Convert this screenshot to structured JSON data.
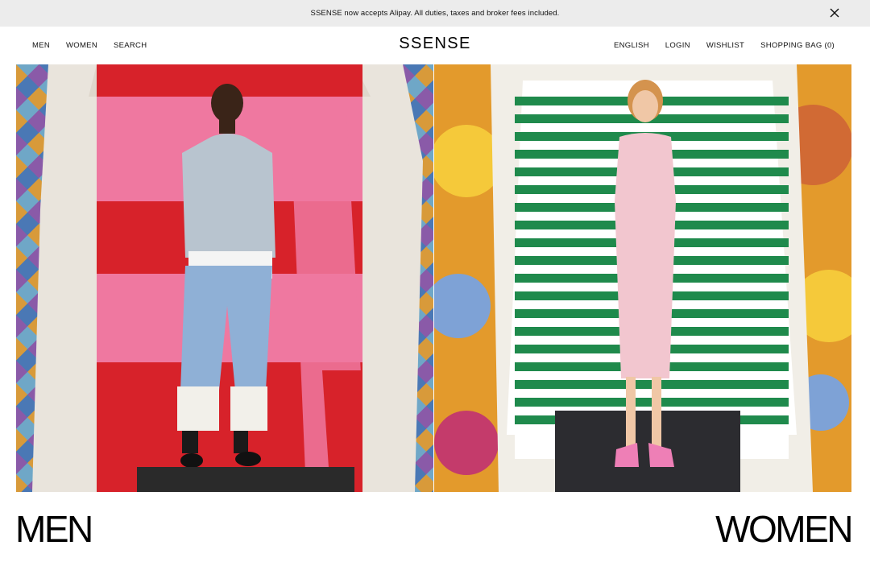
{
  "announcement": {
    "text": "SSENSE now accepts Alipay. All duties, taxes and broker fees included.",
    "close_icon": "close-icon"
  },
  "header": {
    "logo": "SSENSE",
    "nav_left": [
      {
        "label": "MEN"
      },
      {
        "label": "WOMEN"
      },
      {
        "label": "SEARCH"
      }
    ],
    "nav_right": [
      {
        "label": "ENGLISH"
      },
      {
        "label": "LOGIN"
      },
      {
        "label": "WISHLIST"
      },
      {
        "label": "SHOPPING BAG (0)"
      }
    ]
  },
  "hero": {
    "men_label": "MEN",
    "women_label": "WOMEN"
  },
  "colors": {
    "announce_bg": "#ececec",
    "text": "#000000",
    "men_red": "#d7222a",
    "men_pink": "#ef78a0",
    "women_green": "#1f8a4c",
    "women_pink": "#f2c6cf"
  }
}
